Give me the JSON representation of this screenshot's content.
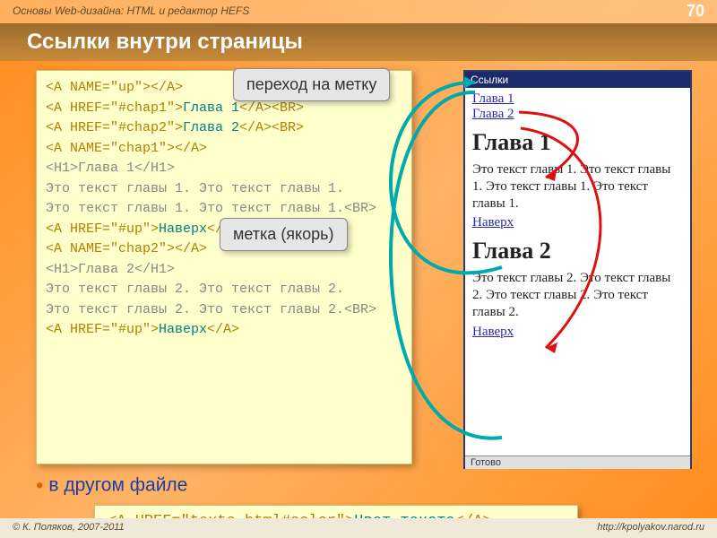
{
  "header": {
    "course": "Основы Web-дизайна: HTML и редактор HEFS",
    "page_num": "70"
  },
  "title": "Ссылки внутри страницы",
  "callouts": {
    "jump": "переход на метку",
    "anchor": "метка (якорь)"
  },
  "code": {
    "l1a": "<A NAME=\"up\">",
    "l1b": "</A>",
    "l2a": "<A HREF=\"#chap1\">",
    "l2b": "Глава 1",
    "l2c": "</A><BR>",
    "l3a": "<A HREF=\"#chap2\">",
    "l3b": "Глава 2",
    "l3c": "</A><BR>",
    "l4a": "<A NAME=\"chap1\">",
    "l4b": "</A>",
    "l5": "<H1>Глава 1</H1>",
    "l6": "Это текст главы 1. Это текст главы 1.",
    "l7": "Это текст главы 1. Это текст главы 1.<BR>",
    "l8a": "<A HREF=\"#up\">",
    "l8b": "Наверх",
    "l8c": "</A>",
    "l9a": "<A NAME=\"chap2\">",
    "l9b": "</A>",
    "l10": "<H1>Глава 2</H1>",
    "l11": "Это текст главы 2. Это текст главы 2.",
    "l12": "Это текст главы 2. Это текст главы 2.<BR>",
    "l13a": "<A HREF=\"#up\">",
    "l13b": "Наверх",
    "l13c": "</A>"
  },
  "preview": {
    "window_title": "Ссылки",
    "link1": "Глава 1",
    "link2": "Глава 2",
    "h1": "Глава 1",
    "p1": "Это текст главы 1. Это текст главы 1. Это текст главы 1. Это текст главы 1.",
    "up1": "Наверх",
    "h2": "Глава 2",
    "p2": "Это текст главы 2. Это текст главы 2. Это текст главы 2. Это текст главы 2.",
    "up2": "Наверх",
    "status": "Готово"
  },
  "other_file": "в другом файле",
  "bottom_code": {
    "a": "<A HREF=\"texts.html#color\">",
    "b": "Цвет текста",
    "c": "</A>"
  },
  "footer": {
    "copyright": "© К. Поляков, 2007-2011",
    "url": "http://kpolyakov.narod.ru"
  }
}
